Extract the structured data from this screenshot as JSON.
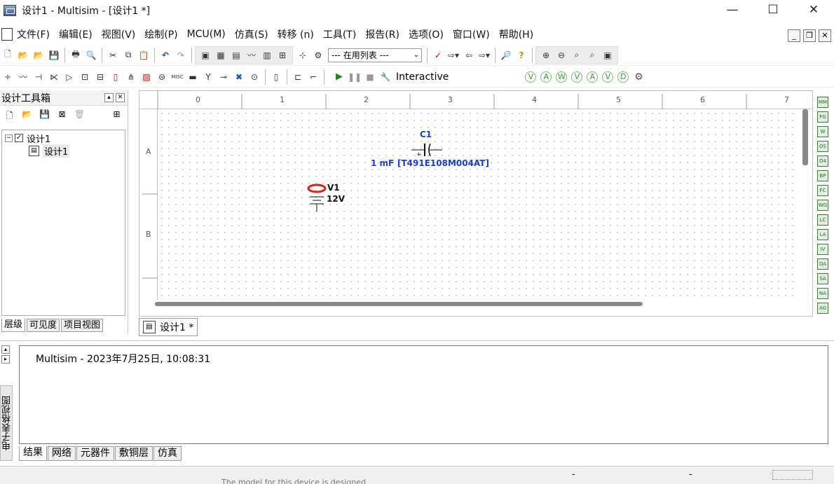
{
  "window": {
    "title": "设计1 - Multisim - [设计1 *]",
    "controls": {
      "minimize": "—",
      "maximize": "☐",
      "close": "✕"
    }
  },
  "menu": {
    "items": [
      "文件(F)",
      "编辑(E)",
      "视图(V)",
      "绘制(P)",
      "MCU(M)",
      "仿真(S)",
      "转移 (n)",
      "工具(T)",
      "报告(R)",
      "选项(O)",
      "窗口(W)",
      "帮助(H)"
    ]
  },
  "toolbar": {
    "in_use_list": "--- 在用列表 ---",
    "sim_mode": "Interactive"
  },
  "toolbox": {
    "title": "设计工具箱",
    "tree": {
      "root": "设计1",
      "child": "设计1"
    },
    "tabs": [
      "层级",
      "可见度",
      "项目视图"
    ]
  },
  "canvas": {
    "ruler_cols": [
      "0",
      "1",
      "2",
      "3",
      "4",
      "5",
      "6",
      "7"
    ],
    "ruler_rows": [
      "A",
      "B"
    ],
    "capacitor": {
      "ref": "C1",
      "value": "1 mF",
      "part": "[T491E108M004AT]"
    },
    "source": {
      "ref": "V1",
      "value": "12V"
    }
  },
  "sheet_tab": {
    "label": "设计1 *"
  },
  "output": {
    "side_label": "电子表格视图",
    "log_line": "Multisim  -  2023年7月25日, 10:08:31",
    "tabs": [
      "结果",
      "网络",
      "元器件",
      "敷铜层",
      "仿真"
    ]
  },
  "statusbar": {
    "note": "The model for this device is designed",
    "field1": "-",
    "field2": "-"
  }
}
